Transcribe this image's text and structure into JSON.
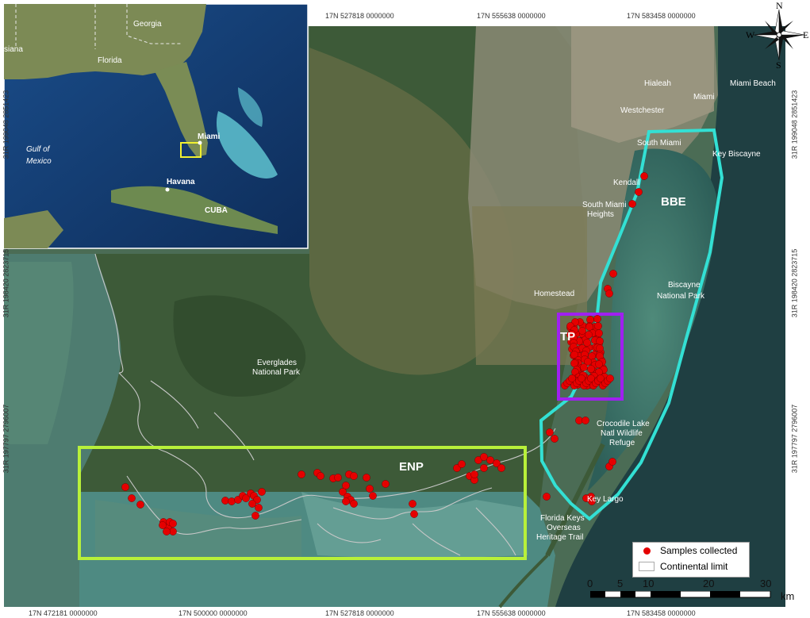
{
  "top_coords": [
    "17N 527818 0000000",
    "17N 555638 0000000",
    "17N 583458 0000000"
  ],
  "bottom_coords": [
    "17N 472181 0000000",
    "17N 500000 0000000",
    "17N 527818 0000000",
    "17N 555638 0000000",
    "17N 583458 0000000"
  ],
  "right_coords": [
    "31R 199048 2851423",
    "31R 198420 2823715",
    "31R 197797 2796007"
  ],
  "left_coords": [
    "31R 199048 2851423",
    "31R 198420 2823715",
    "31R 197797 2796007"
  ],
  "inset": {
    "labels": {
      "georgia": "Georgia",
      "louisiana": "siana",
      "florida": "Florida",
      "gulf1": "Gulf of",
      "gulf2": "Mexico",
      "miami": "Miami",
      "havana": "Havana",
      "cuba": "CUBA"
    }
  },
  "places": {
    "hialeah": "Hialeah",
    "miami_beach": "Miami Beach",
    "miami": "Miami",
    "westchester": "Westchester",
    "south_miami": "South Miami",
    "key_biscayne": "Key Biscayne",
    "kendall": "Kendall",
    "south_miami_heights_1": "South Miami",
    "south_miami_heights_2": "Heights",
    "homestead": "Homestead",
    "biscayne_np_1": "Biscayne",
    "biscayne_np_2": "National Park",
    "everglades_np_1": "Everglades",
    "everglades_np_2": "National Park",
    "crocodile_1": "Crocodile Lake",
    "crocodile_2": "Natl Wildlife",
    "crocodile_3": "Refuge",
    "key_largo": "Key Largo",
    "fk_1": "Florida Keys",
    "fk_2": "Overseas",
    "fk_3": "Heritage Trail"
  },
  "regions": {
    "bbe": "BBE",
    "tp": "TP",
    "enp": "ENP"
  },
  "compass": {
    "n": "N",
    "s": "S",
    "e": "E",
    "w": "W"
  },
  "legend": {
    "samples": "Samples collected",
    "limit": "Continental limit"
  },
  "scale": {
    "ticks": [
      "0",
      "5",
      "10",
      "20",
      "30"
    ],
    "unit": "km"
  },
  "colors": {
    "samples": "#e50000",
    "bbe": "#33e0d4",
    "tp": "#a020f0",
    "enp": "#b8f03a",
    "frame": "#c8d238"
  }
}
